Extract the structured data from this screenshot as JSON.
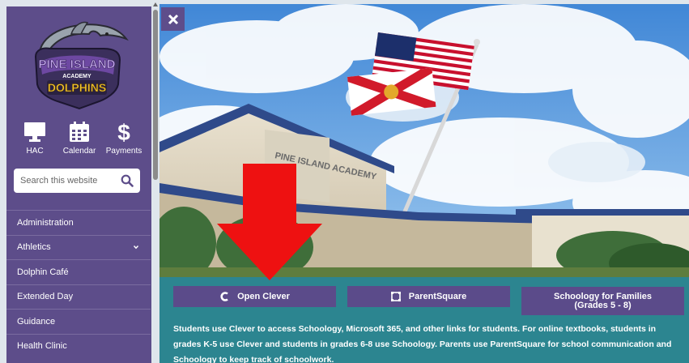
{
  "school": {
    "logo_line1": "PINE ISLAND",
    "logo_line2": "ACADEMY",
    "logo_line3": "DOLPHINS"
  },
  "quick_links": [
    {
      "label": "HAC",
      "icon": "monitor-icon"
    },
    {
      "label": "Calendar",
      "icon": "calendar-icon"
    },
    {
      "label": "Payments",
      "icon": "dollar-icon"
    }
  ],
  "search": {
    "placeholder": "Search this website"
  },
  "nav": [
    {
      "label": "Administration"
    },
    {
      "label": "Athletics",
      "has_submenu": true
    },
    {
      "label": "Dolphin Café"
    },
    {
      "label": "Extended Day"
    },
    {
      "label": "Guidance"
    },
    {
      "label": "Health Clinic"
    }
  ],
  "hero": {
    "building_sign": "PINE ISLAND ACADEMY"
  },
  "buttons": {
    "clever": "Open Clever",
    "parentsquare": "ParentSquare",
    "schoology_line1": "Schoology for Families",
    "schoology_line2": "(Grades 5 - 8)"
  },
  "info_text": "Students use Clever to access Schoology, Microsoft 365, and other links for students. For online textbooks, students in grades K-5 use Clever and students in grades 6-8 use Schoology. Parents use ParentSquare for school communication and Schoology to keep track of schoolwork.",
  "colors": {
    "sidebar": "#5d4d8a",
    "teal": "#2c8590",
    "button": "#5b4b8a",
    "arrow": "#ee1111"
  }
}
